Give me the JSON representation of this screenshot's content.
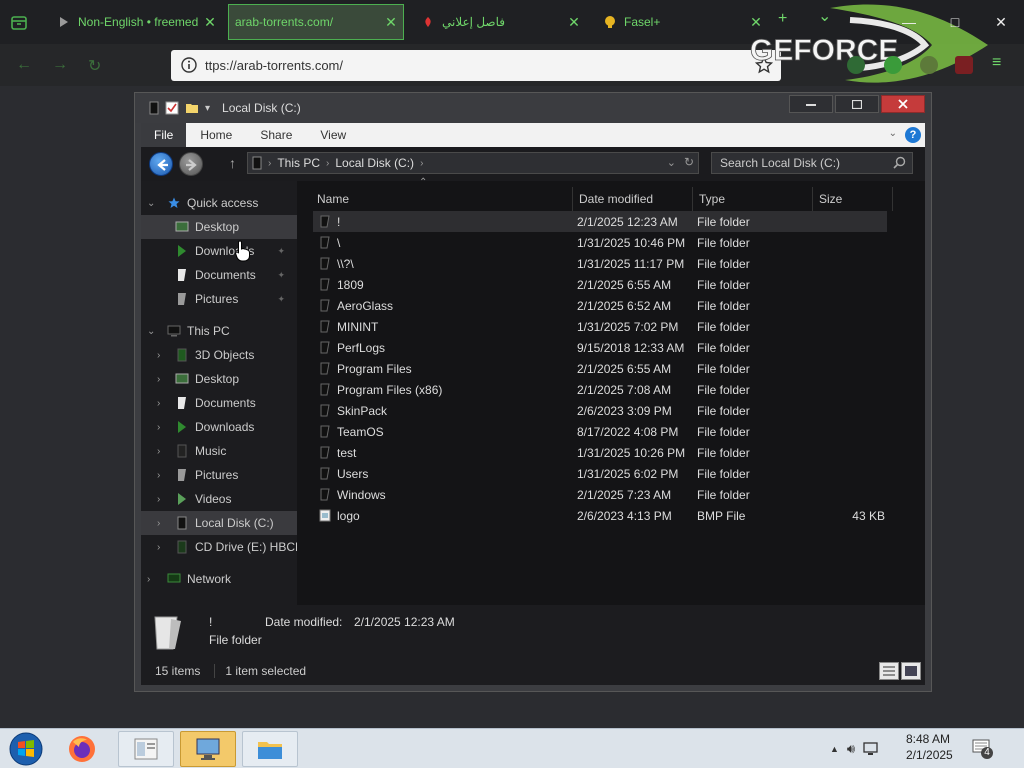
{
  "browser": {
    "tabs": [
      {
        "title": "Non-English • freemed",
        "close": "✕"
      },
      {
        "title": "arab-torrents.com/",
        "close": "✕"
      },
      {
        "title": "فاصل إعلاني",
        "close": "✕"
      },
      {
        "title": "Fasel+",
        "close": "✕"
      }
    ],
    "new_tab": "+",
    "tab_menu": "⌄",
    "url": "ttps://arab-torrents.com/",
    "geforce_logo": "GEFORCE",
    "controls": {
      "minimize": "—",
      "maximize": "□",
      "close": "✕"
    }
  },
  "explorer": {
    "title": "Local Disk (C:)",
    "ribbon_tabs": [
      "File",
      "Home",
      "Share",
      "View"
    ],
    "help": "?",
    "breadcrumb": [
      "This PC",
      "Local Disk (C:)"
    ],
    "search_placeholder": "Search Local Disk (C:)",
    "nav": {
      "quick_access": "Quick access",
      "quick_items": [
        "Desktop",
        "Downloads",
        "Documents",
        "Pictures"
      ],
      "this_pc": "This PC",
      "pc_items": [
        "3D Objects",
        "Desktop",
        "Documents",
        "Downloads",
        "Music",
        "Pictures",
        "Videos",
        "Local Disk (C:)",
        "CD Drive (E:) HBCD_"
      ],
      "network": "Network"
    },
    "columns": {
      "name": "Name",
      "date": "Date modified",
      "type": "Type",
      "size": "Size"
    },
    "files": [
      {
        "name": "!",
        "date": "2/1/2025 12:23 AM",
        "type": "File folder",
        "size": ""
      },
      {
        "name": "\\",
        "date": "1/31/2025 10:46 PM",
        "type": "File folder",
        "size": ""
      },
      {
        "name": "\\\\?\\",
        "date": "1/31/2025 11:17 PM",
        "type": "File folder",
        "size": ""
      },
      {
        "name": "1809",
        "date": "2/1/2025 6:55 AM",
        "type": "File folder",
        "size": ""
      },
      {
        "name": "AeroGlass",
        "date": "2/1/2025 6:52 AM",
        "type": "File folder",
        "size": ""
      },
      {
        "name": "MININT",
        "date": "1/31/2025 7:02 PM",
        "type": "File folder",
        "size": ""
      },
      {
        "name": "PerfLogs",
        "date": "9/15/2018 12:33 AM",
        "type": "File folder",
        "size": ""
      },
      {
        "name": "Program Files",
        "date": "2/1/2025 6:55 AM",
        "type": "File folder",
        "size": ""
      },
      {
        "name": "Program Files (x86)",
        "date": "2/1/2025 7:08 AM",
        "type": "File folder",
        "size": ""
      },
      {
        "name": "SkinPack",
        "date": "2/6/2023 3:09 PM",
        "type": "File folder",
        "size": ""
      },
      {
        "name": "TeamOS",
        "date": "8/17/2022 4:08 PM",
        "type": "File folder",
        "size": ""
      },
      {
        "name": "test",
        "date": "1/31/2025 10:26 PM",
        "type": "File folder",
        "size": ""
      },
      {
        "name": "Users",
        "date": "1/31/2025 6:02 PM",
        "type": "File folder",
        "size": ""
      },
      {
        "name": "Windows",
        "date": "2/1/2025 7:23 AM",
        "type": "File folder",
        "size": ""
      },
      {
        "name": "logo",
        "date": "2/6/2023 4:13 PM",
        "type": "BMP File",
        "size": "43 KB"
      }
    ],
    "details": {
      "name": "!",
      "date_label": "Date modified:",
      "date_value": "2/1/2025 12:23 AM",
      "type": "File folder"
    },
    "status": {
      "items": "15 items",
      "selected": "1 item selected"
    }
  },
  "taskbar": {
    "time": "8:48 AM",
    "date": "2/1/2025",
    "notifications": "4"
  }
}
